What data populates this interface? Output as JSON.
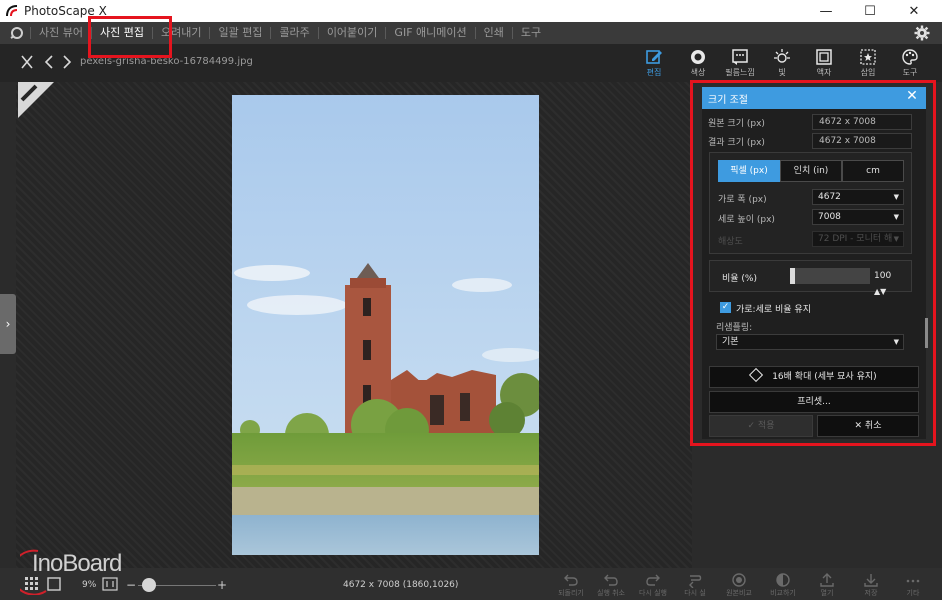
{
  "window": {
    "title": "PhotoScape X",
    "minimize": "—",
    "maximize": "☐",
    "close": "✕"
  },
  "tabs": [
    {
      "label": "사진 뷰어",
      "active": false
    },
    {
      "label": "사진 편집",
      "active": true
    },
    {
      "label": "오려내기",
      "active": false
    },
    {
      "label": "일괄 편집",
      "active": false
    },
    {
      "label": "콜라주",
      "active": false
    },
    {
      "label": "이어붙이기",
      "active": false
    },
    {
      "label": "GIF 애니메이션",
      "active": false
    },
    {
      "label": "인쇄",
      "active": false
    },
    {
      "label": "도구",
      "active": false
    }
  ],
  "file": {
    "name": "pexels-grisha-besko-16784499.jpg"
  },
  "toolbar": {
    "items": [
      {
        "label": "편집",
        "icon": "edit-icon"
      },
      {
        "label": "색상",
        "icon": "color-icon"
      },
      {
        "label": "필름느낌",
        "icon": "film-icon"
      },
      {
        "label": "빛",
        "icon": "light-icon"
      },
      {
        "label": "액자",
        "icon": "frame-icon"
      },
      {
        "label": "삽입",
        "icon": "insert-icon"
      },
      {
        "label": "도구",
        "icon": "palette-icon"
      }
    ]
  },
  "resize_panel": {
    "title": "크기 조절",
    "original_label": "원본 크기 (px)",
    "original_value": "4672 x 7008",
    "result_label": "결과 크기 (px)",
    "result_value": "4672 x 7008",
    "units": [
      "픽셀 (px)",
      "인치 (in)",
      "cm"
    ],
    "width_label": "가로 폭 (px)",
    "width_value": "4672",
    "height_label": "세로 높이 (px)",
    "height_value": "7008",
    "dpi_label": "해상도",
    "dpi_value": "72 DPI - 모니터 해",
    "ratio_label": "비율 (%)",
    "ratio_value": "100",
    "ratio_fraction": 0.0,
    "keep_ratio_label": "가로:세로 비율 유지",
    "keep_ratio_checked": true,
    "resample_label": "리샘플링:",
    "resample_value": "기본",
    "upscale_label": "16배 확대 (세부 묘사 유지)",
    "preset_label": "프리셋...",
    "apply_label": "적용",
    "cancel_label": "취소"
  },
  "status": {
    "zoom": "9%",
    "size": "4672 x 7008 (1860,1026)"
  },
  "bottom_tools": [
    {
      "label": "되돌리기",
      "icon": "undo-all-icon"
    },
    {
      "label": "실행 취소",
      "icon": "undo-icon"
    },
    {
      "label": "다시 실행",
      "icon": "redo-icon"
    },
    {
      "label": "다시 실",
      "icon": "repeat-icon"
    },
    {
      "label": "원본비교",
      "icon": "compare-icon"
    },
    {
      "label": "비교하기",
      "icon": "compare2-icon"
    },
    {
      "label": "열기",
      "icon": "export-icon"
    },
    {
      "label": "저장",
      "icon": "save-icon"
    },
    {
      "label": "기타",
      "icon": "more-icon"
    }
  ],
  "watermark": {
    "text": "InoBoard"
  },
  "colors": {
    "accent": "#3e9be0",
    "highlight": "#e5141e"
  }
}
